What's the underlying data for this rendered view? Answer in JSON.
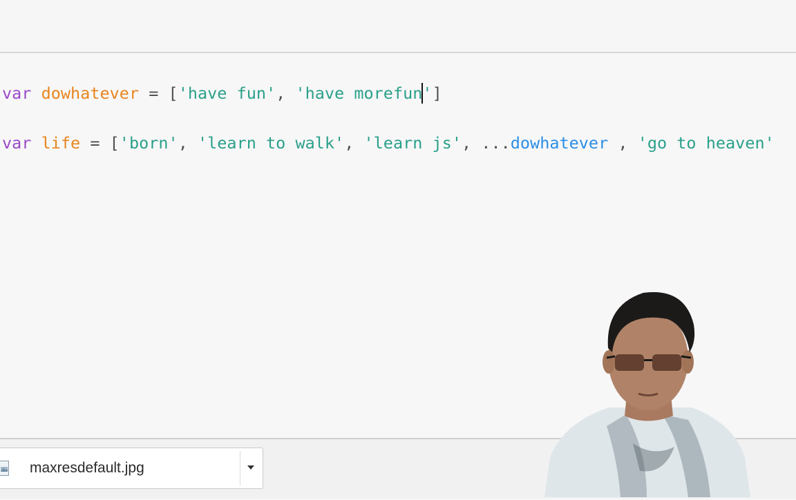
{
  "editor": {
    "line1": {
      "keyword": "var",
      "name": "dowhatever",
      "assign": " = [",
      "str1": "'have fun'",
      "sep1": ", ",
      "str2_before_cursor": "'have morefun",
      "str2_after_cursor": "'",
      "close": "]"
    },
    "line2": {
      "keyword": "var",
      "name": "life",
      "assign": " = [",
      "str1": "'born'",
      "sep1": ", ",
      "str2": "'learn to walk'",
      "sep2": ", ",
      "str3": "'learn js'",
      "sep3": ", ...",
      "spread": "dowhatever",
      "sep4": " , ",
      "str4": "'go to heaven'"
    }
  },
  "download_bar": {
    "file_name": "maxresdefault.jpg",
    "file_icon": "image-file-icon",
    "menu_icon": "caret-down-icon"
  },
  "colors": {
    "keyword": "#9a49c9",
    "variable": "#e8851f",
    "string": "#2aa08a",
    "spread_identifier": "#2a8ee6"
  }
}
